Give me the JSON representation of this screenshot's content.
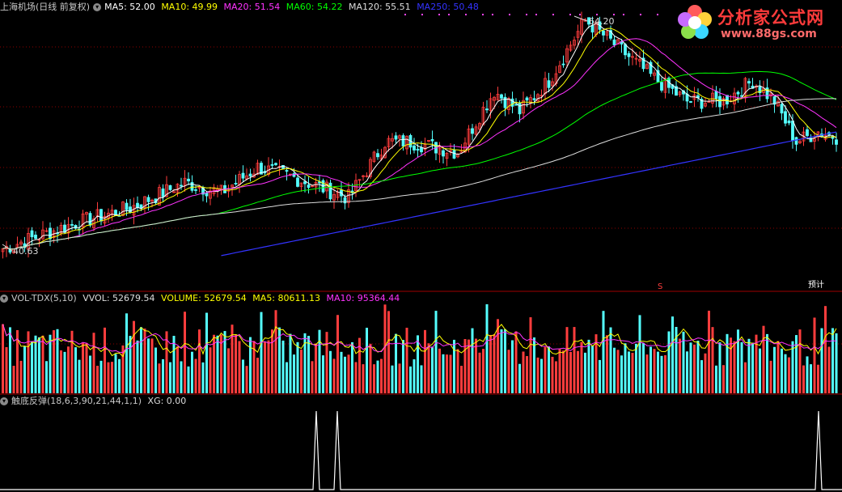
{
  "main_header": {
    "stock_title": "上海机场(日线 前复权)",
    "ma5": "MA5: 52.00",
    "ma10": "MA10: 49.99",
    "ma20": "MA20: 51.54",
    "ma60": "MA60: 54.22",
    "ma120": "MA120: 55.51",
    "ma250": "MA250: 50.48"
  },
  "price_labels": {
    "high": "64.20",
    "low": "40.63",
    "marker_s": "S",
    "marker_note": "预计"
  },
  "volume_header": {
    "indicator": "VOL-TDX(5,10)",
    "vvol": "VVOL: 52679.54",
    "volume": "VOLUME: 52679.54",
    "ma5": "MA5: 80611.13",
    "ma10": "MA10: 95364.44"
  },
  "signal_header": {
    "indicator": "触底反弹(18,6,3,90,21,44,1,1)",
    "xg": "XG: 0.00"
  },
  "logo": {
    "title": "分析家公式网",
    "url": "www.88gs.com"
  },
  "colors": {
    "up": "#ff3d3d",
    "down": "#54ffff",
    "ma5": "#ffffff",
    "ma10": "#ffff00",
    "ma20": "#ff33ff",
    "ma60": "#00ff00",
    "ma120": "#dddddd",
    "ma250": "#3333ff",
    "grid": "#8b0000"
  },
  "chart_data": [
    {
      "type": "candlestick",
      "title": "上海机场(日线 前复权)",
      "series": [
        {
          "name": "MA5",
          "value": 52.0
        },
        {
          "name": "MA10",
          "value": 49.99
        },
        {
          "name": "MA20",
          "value": 51.54
        },
        {
          "name": "MA60",
          "value": 54.22
        },
        {
          "name": "MA120",
          "value": 55.51
        },
        {
          "name": "MA250",
          "value": 50.48
        }
      ],
      "annotations": [
        {
          "label": "64.20"
        },
        {
          "label": "40.63"
        }
      ],
      "ylim": [
        40.63,
        64.2
      ],
      "grid": true
    },
    {
      "type": "bar",
      "title": "VOL-TDX(5,10)",
      "series": [
        {
          "name": "VVOL",
          "value": 52679.54
        },
        {
          "name": "VOLUME",
          "value": 52679.54
        },
        {
          "name": "MA5",
          "value": 80611.13
        },
        {
          "name": "MA10",
          "value": 95364.44
        }
      ]
    },
    {
      "type": "line",
      "title": "触底反弹(18,6,3,90,21,44,1,1)",
      "series": [
        {
          "name": "XG",
          "value": 0.0
        }
      ]
    }
  ]
}
